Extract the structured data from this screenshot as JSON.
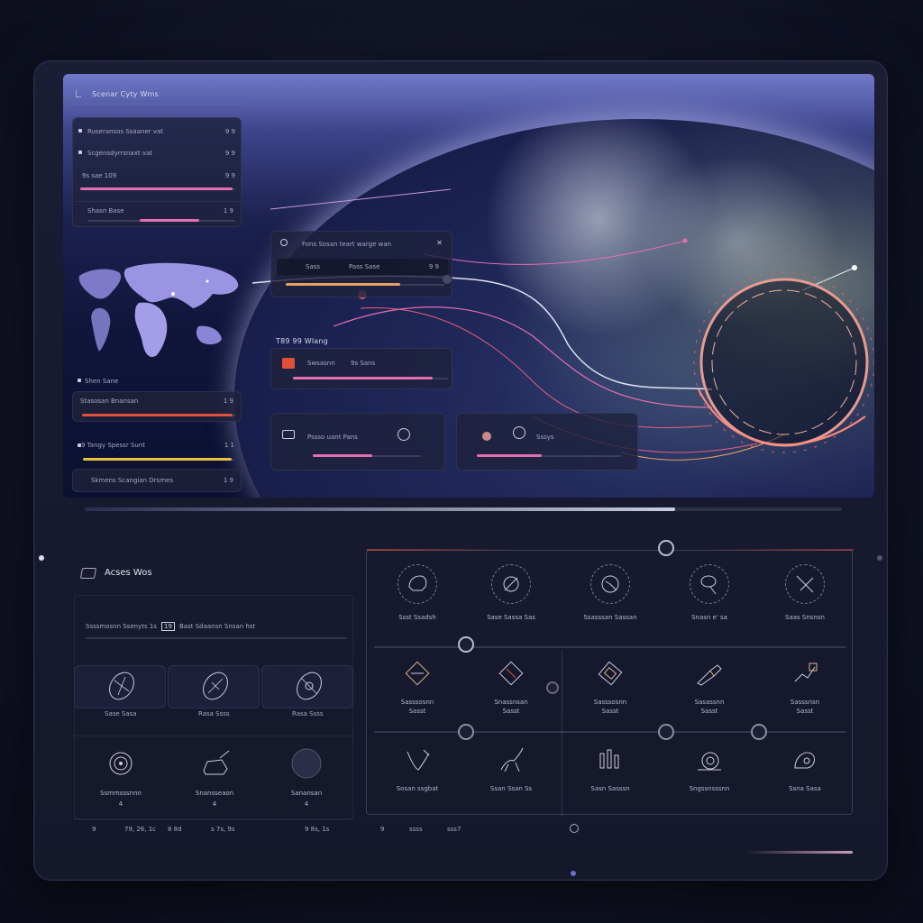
{
  "colors": {
    "accent_pink": "#e46fb0",
    "accent_red": "#e0503a",
    "accent_yellow": "#e8c23c",
    "accent_orange": "#e8a160",
    "panel_bg": "#1e223c",
    "frame_bg": "#15182b"
  },
  "header": {
    "title": "Scenar Cyty Wms"
  },
  "left_panel": {
    "rows": [
      {
        "label": "Ruseransos Ssaaner vat",
        "value": "9 9"
      },
      {
        "label": "Scgensdyrrsnaxt vat",
        "value": "9 9"
      },
      {
        "label": "9s sae 109",
        "value": "9 9",
        "progress": 0.98
      },
      {
        "label": "Shasn Base",
        "value": "1 9",
        "progress": 0.62
      }
    ],
    "map_icon": "world-map-icon",
    "rows2": [
      {
        "label": "Shen Sane",
        "value": ""
      },
      {
        "label": "Stasosan Bnansan",
        "value": "1 9",
        "progress": 0.98
      },
      {
        "label": "9 Tangy Spessr Sunt",
        "value": "1 1",
        "progress": 0.98
      },
      {
        "label": "Skmens Scangian Drsmes",
        "value": "1 9"
      }
    ]
  },
  "overlay_cards": {
    "card1": {
      "title": "Fons Sosan teart warge wan",
      "row_label": "Sass",
      "row_label2": "Pass Sase",
      "row_value": "9 9",
      "progress": 0.72
    },
    "card2": {
      "title": "T89 99 Wlang",
      "row_label": "Swsasnn",
      "row_label2": "9s Sans",
      "progress": 0.9
    },
    "card3": {
      "label": "Pssso uant Pans",
      "progress": 0.55
    },
    "card4": {
      "label": "Sssys",
      "progress": 0.45
    }
  },
  "lower_left": {
    "title": "Acses Wos",
    "subtitle_left": "Ssssmosnn Ssenyts 1s",
    "subtitle_badge": "19",
    "subtitle_right": "Bast Sdaansn Snsan hst",
    "tiles_row1": [
      {
        "icon": "mouse-device-icon",
        "label": "Sase Sasa"
      },
      {
        "icon": "hand-tool-icon",
        "label": "Rasa Ssss"
      },
      {
        "icon": "gear-device-icon",
        "label": "Rasa Ssss"
      }
    ],
    "tiles_row2": [
      {
        "icon": "spiral-icon",
        "label": "Ssmmsssnnn",
        "sub": "4"
      },
      {
        "icon": "vehicle-icon",
        "label": "Snansseaon",
        "sub": "4"
      },
      {
        "icon": "record-disc-icon",
        "label": "Sanansan",
        "sub": "4"
      }
    ],
    "footer": [
      "9",
      "79, 26, 1c",
      "8 8d",
      "s 7s, 9s",
      "9 8s, 1s"
    ]
  },
  "grid": {
    "row1": [
      {
        "icon": "helmet-icon",
        "label": "Ssst Ssadsh"
      },
      {
        "icon": "compass-icon",
        "label": "Sase Sassa Sas"
      },
      {
        "icon": "radar-icon",
        "label": "Ssasssan Sassan"
      },
      {
        "icon": "lasso-icon",
        "label": "Snasn e' sa"
      },
      {
        "icon": "tools-icon",
        "label": "Saas Snsnsn"
      }
    ],
    "row2": [
      {
        "icon": "box-icon",
        "label": "Sasssosnn",
        "sub": "Sasst"
      },
      {
        "icon": "diamond-icon",
        "label": "Snassnsan",
        "sub": "Sasst"
      },
      {
        "icon": "card-icon",
        "label": "Sasssosnn",
        "sub": "Sasst"
      },
      {
        "icon": "drill-icon",
        "label": "Sasassnn",
        "sub": "Sasst"
      },
      {
        "icon": "robot-arm-icon",
        "label": "Sasssnsn",
        "sub": "Sasst"
      }
    ],
    "row3": [
      {
        "icon": "wand-icon",
        "label": "Sosan ssgbat"
      },
      {
        "icon": "creature-icon",
        "label": "Ssan Ssan Ss"
      },
      {
        "icon": "chart-bar-icon",
        "label": "Sasn Sasssn"
      },
      {
        "icon": "snail-icon",
        "label": "Sngssnsssnn"
      },
      {
        "icon": "shell-icon",
        "label": "Ssna Sasa"
      }
    ],
    "footer": [
      "9",
      "ssss",
      "sss7",
      "9"
    ]
  }
}
